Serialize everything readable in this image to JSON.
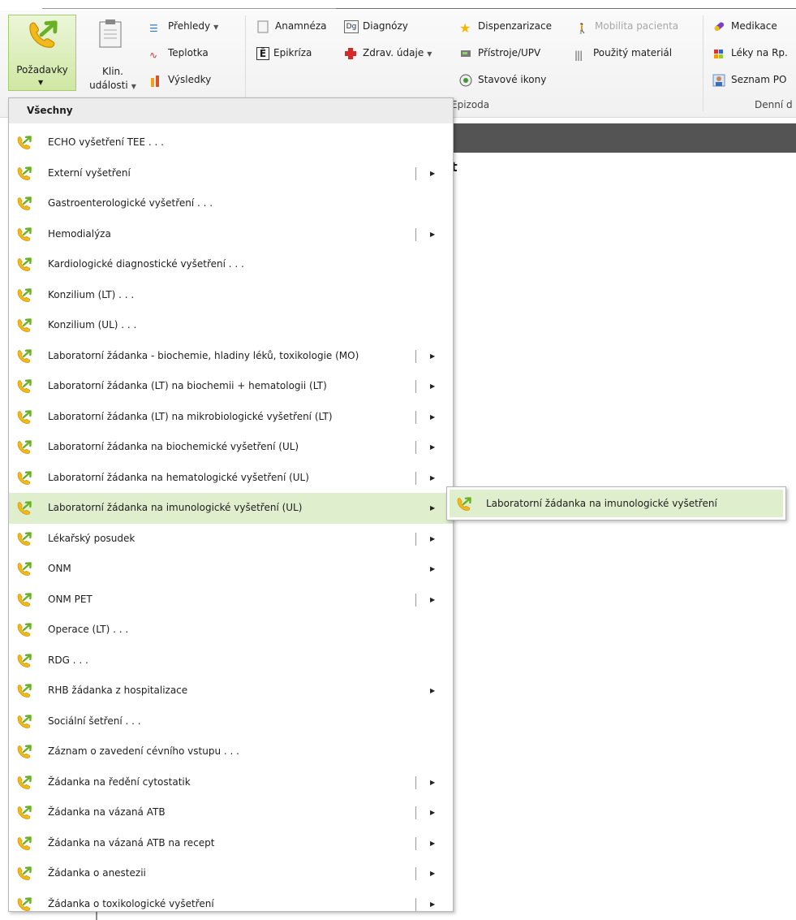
{
  "ribbon": {
    "main_button": {
      "label": "Požadavky"
    },
    "klin": {
      "label_line1": "Klin.",
      "label_line2": "události"
    },
    "col1": {
      "prehledy": "Přehledy",
      "teplotka": "Teplotka",
      "vysledky": "Výsledky"
    },
    "col2": {
      "anamneza": "Anamnéza",
      "diagnozy": "Diagnózy",
      "epikriza": "Epikríza",
      "zdrav_udaje": "Zdrav. údaje"
    },
    "col3": {
      "dispenzarizace": "Dispenzarizace",
      "mobilita": "Mobilita pacienta",
      "pristroje": "Přístroje/UPV",
      "pouzity_material": "Použitý materiál",
      "stavove_ikony": "Stavové ikony"
    },
    "col4": {
      "medikace": "Medikace",
      "leky_na_rp": "Léky na Rp.",
      "seznam_po": "Seznam PO"
    },
    "groups": {
      "epizoda": "Epizoda",
      "denni": "Denní d"
    }
  },
  "menu": {
    "header": "Všechny",
    "items": [
      {
        "label": "ECHO vyšetření TEE . . .",
        "submenu": false,
        "sep": false
      },
      {
        "label": "Externí vyšetření",
        "submenu": true,
        "sep": true
      },
      {
        "label": "Gastroenterologické vyšetření . . .",
        "submenu": false,
        "sep": false
      },
      {
        "label": "Hemodialýza",
        "submenu": true,
        "sep": true
      },
      {
        "label": "Kardiologické diagnostické vyšetření . . .",
        "submenu": false,
        "sep": false
      },
      {
        "label": "Konzilium (LT) . . .",
        "submenu": false,
        "sep": false
      },
      {
        "label": "Konzilium (UL) . . .",
        "submenu": false,
        "sep": false
      },
      {
        "label": "Laboratorní žádanka - biochemie, hladiny léků, toxikologie (MO)",
        "submenu": true,
        "sep": true
      },
      {
        "label": "Laboratorní žádanka (LT) na biochemii + hematologii (LT)",
        "submenu": true,
        "sep": true
      },
      {
        "label": "Laboratorní žádanka (LT) na mikrobiologické vyšetření (LT)",
        "submenu": true,
        "sep": true
      },
      {
        "label": "Laboratorní žádanka na biochemické vyšetření (UL)",
        "submenu": true,
        "sep": true
      },
      {
        "label": "Laboratorní žádanka na hematologické vyšetření (UL)",
        "submenu": true,
        "sep": true
      },
      {
        "label": "Laboratorní žádanka na imunologické vyšetření (UL)",
        "submenu": true,
        "sep": false,
        "selected": true
      },
      {
        "label": "Lékařský posudek",
        "submenu": true,
        "sep": true
      },
      {
        "label": "ONM",
        "submenu": true,
        "sep": false
      },
      {
        "label": "ONM PET",
        "submenu": true,
        "sep": true
      },
      {
        "label": "Operace (LT) . . .",
        "submenu": false,
        "sep": false
      },
      {
        "label": "RDG . . .",
        "submenu": false,
        "sep": false
      },
      {
        "label": "RHB žádanka z hospitalizace",
        "submenu": true,
        "sep": false
      },
      {
        "label": "Sociální šetření . . .",
        "submenu": false,
        "sep": false
      },
      {
        "label": "Záznam o zavedení cévního vstupu . . .",
        "submenu": false,
        "sep": false
      },
      {
        "label": "Žádanka na ředění cytostatik",
        "submenu": true,
        "sep": true
      },
      {
        "label": "Žádanka na vázaná ATB",
        "submenu": true,
        "sep": true
      },
      {
        "label": "Žádanka na vázaná ATB na recept",
        "submenu": true,
        "sep": true
      },
      {
        "label": "Žádanka o anestezii",
        "submenu": true,
        "sep": true
      },
      {
        "label": "Žádanka o toxikologické vyšetření",
        "submenu": true,
        "sep": true
      }
    ]
  },
  "submenu": {
    "label": "Laboratorní žádanka na imunologické vyšetření"
  },
  "background": {
    "partial_char": "t"
  },
  "colors": {
    "selected_bg": "#dfeecd",
    "accent_green": "#7dbd2c",
    "phone_yellow": "#f2b91a"
  }
}
